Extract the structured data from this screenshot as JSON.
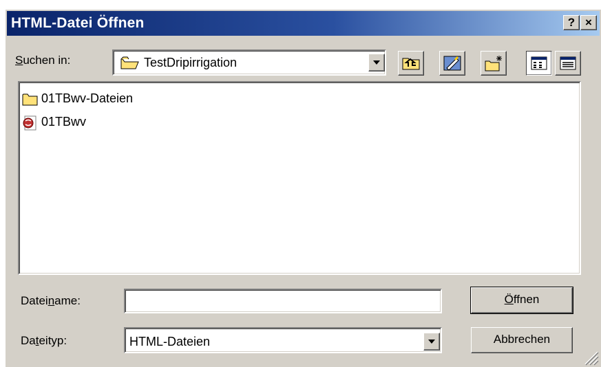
{
  "window": {
    "title": "HTML-Datei Öffnen",
    "help_label": "?",
    "close_label": "×"
  },
  "look_in": {
    "label_underlined": "S",
    "label_rest": "uchen in:",
    "value": "TestDripirrigation"
  },
  "toolbar": {
    "icons": [
      "folder-up-icon",
      "desktop-icon",
      "new-folder-icon",
      "list-view-icon",
      "details-view-icon"
    ]
  },
  "files": [
    {
      "name": "01TBwv-Dateien",
      "icon": "folder-icon"
    },
    {
      "name": "01TBwv",
      "icon": "html-file-icon"
    }
  ],
  "filename": {
    "label_pre": "Datei",
    "label_underlined": "n",
    "label_post": "ame:",
    "value": ""
  },
  "filetype": {
    "label_pre": "Da",
    "label_underlined": "t",
    "label_post": "eityp:",
    "value": "HTML-Dateien"
  },
  "buttons": {
    "open_underlined": "Ö",
    "open_rest": "ffnen",
    "cancel": "Abbrechen"
  },
  "colors": {
    "titlebar_start": "#0a246a",
    "titlebar_end": "#a6caf0",
    "face": "#d4d0c8"
  }
}
